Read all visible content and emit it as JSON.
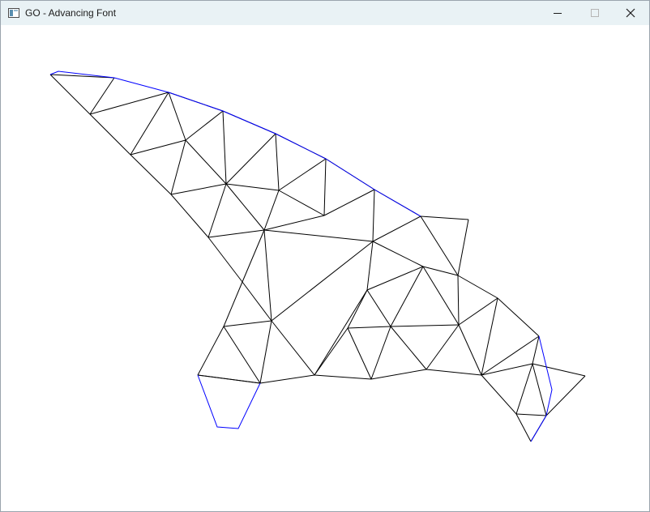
{
  "window": {
    "title": "GO - Advancing Font",
    "icons": {
      "app": "window-app-icon",
      "minimize": "minimize-icon",
      "maximize": "maximize-icon",
      "close": "close-icon"
    }
  },
  "colors": {
    "titlebar": "#e9f2f5",
    "mesh_edge": "#000000",
    "front_edge": "#0000ff",
    "background": "#ffffff"
  }
}
